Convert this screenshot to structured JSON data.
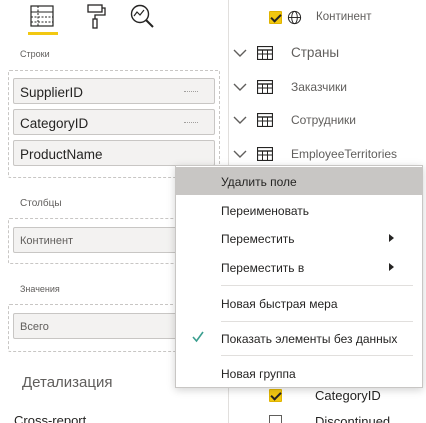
{
  "left_pane": {
    "tabs": [
      {
        "name": "fields-tab",
        "icon": "table-fields-icon",
        "active": true
      },
      {
        "name": "format-tab",
        "icon": "paint-roller-icon",
        "active": false
      },
      {
        "name": "analytics-tab",
        "icon": "magnifier-chart-icon",
        "active": false
      }
    ],
    "rows_label": "Строки",
    "rows_fields": [
      "SupplierID",
      "CategoryID",
      "ProductName"
    ],
    "columns_label": "Столбцы",
    "columns_field": "Континент",
    "values_label": "Значения",
    "values_field": "Всего",
    "drillthrough_title": "Детализация",
    "cross_report_label": "Cross-report"
  },
  "right_pane": {
    "items": [
      {
        "label": "Континент",
        "type": "field",
        "checked": true,
        "icon": "globe-icon"
      },
      {
        "label": "Страны",
        "type": "table"
      },
      {
        "label": "Заказчики",
        "type": "table"
      },
      {
        "label": "Сотрудники",
        "type": "table"
      },
      {
        "label": "EmployeeTerritories",
        "type": "table"
      }
    ],
    "bottom_items": [
      {
        "label": "CategoryID",
        "checked": true
      },
      {
        "label": "Discontinued",
        "checked": false
      }
    ]
  },
  "context_menu": {
    "items": [
      {
        "label": "Удалить поле",
        "highlighted": true
      },
      {
        "label": "Переименовать"
      },
      {
        "label": "Переместить",
        "submenu": true
      },
      {
        "label": "Переместить в",
        "submenu": true
      },
      {
        "label": "Новая быстрая мера"
      },
      {
        "label": "Показать элементы без данных",
        "checked": true
      },
      {
        "label": "Новая группа"
      }
    ]
  },
  "colors": {
    "accent": "#f2c811",
    "check": "#3a9e8f",
    "menu_highlight": "#c8c6c4"
  }
}
